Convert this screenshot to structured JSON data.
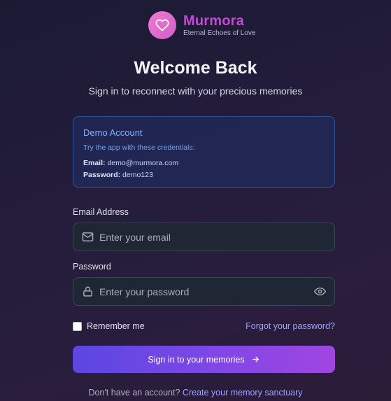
{
  "brand": {
    "name": "Murmora",
    "tagline": "Eternal Echoes of Love",
    "logo_icon": "heart-icon",
    "accent_color": "#c646d9"
  },
  "page": {
    "title": "Welcome Back",
    "subtitle": "Sign in to reconnect with your precious memories"
  },
  "demo": {
    "title": "Demo Account",
    "description": "Try the app with these credentials:",
    "email_label": "Email:",
    "email_value": "demo@murmora.com",
    "password_label": "Password:",
    "password_value": "demo123"
  },
  "form": {
    "email_label": "Email Address",
    "email_placeholder": "Enter your email",
    "email_icon": "mail-icon",
    "password_label": "Password",
    "password_placeholder": "Enter your password",
    "password_icon": "lock-icon",
    "toggle_icon": "eye-icon",
    "remember_label": "Remember me",
    "forgot_label": "Forgot your password?",
    "submit_label": "Sign in to your memories",
    "submit_icon": "arrow-right-icon"
  },
  "footer": {
    "prompt": "Don't have an account?",
    "link": "Create your memory sanctuary"
  }
}
